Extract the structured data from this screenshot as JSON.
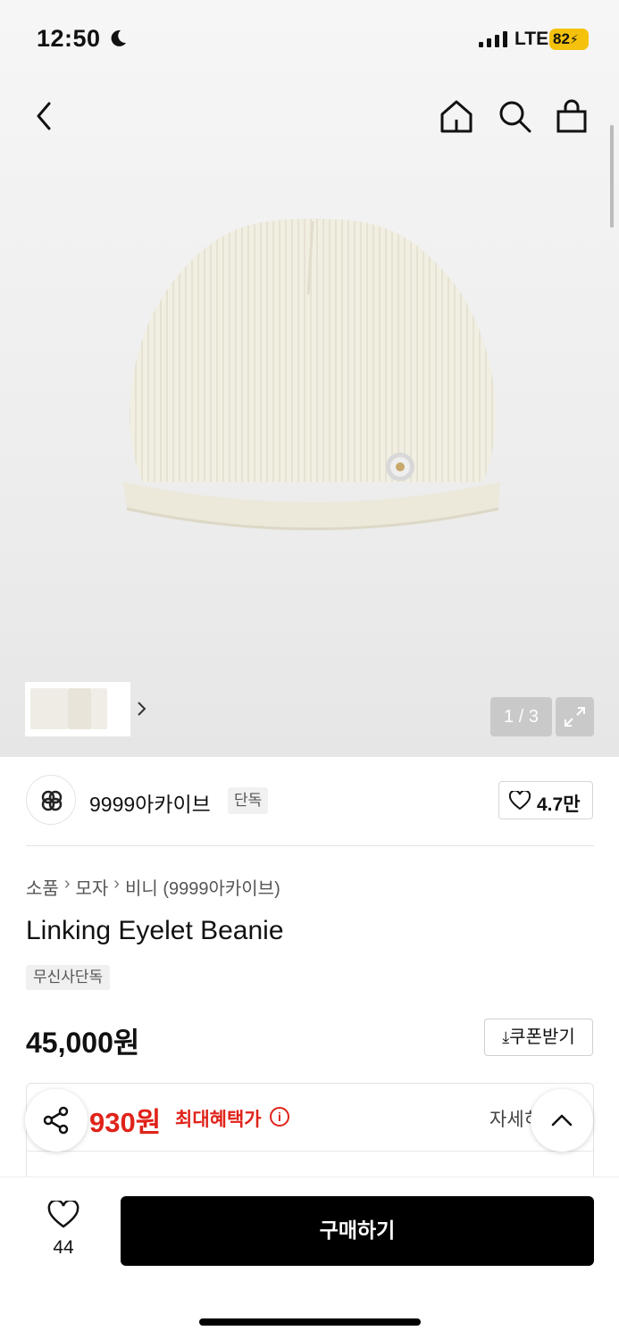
{
  "status_bar": {
    "time": "12:50",
    "network": "LTE",
    "battery": "82"
  },
  "nav": {
    "back_icon": "chevron-left-icon",
    "home_icon": "home-icon",
    "search_icon": "search-icon",
    "bag_icon": "shopping-bag-icon"
  },
  "gallery": {
    "pager": "1 / 3",
    "current_image": 1,
    "total_images": 3
  },
  "brand": {
    "name": "9999아카이브",
    "badge": "단독",
    "likes": "4.7만"
  },
  "breadcrumb": {
    "items": [
      "소품",
      "모자",
      "비니 (9999아카이브)"
    ]
  },
  "product": {
    "title": "Linking Eyelet Beanie",
    "tag": "무신사단독",
    "price": "45,000원"
  },
  "coupon": {
    "label": "쿠폰받기"
  },
  "benefit": {
    "price": "930원",
    "label": "최대혜택가",
    "detail": "자세히"
  },
  "bottom": {
    "wish_count": "44",
    "buy_label": "구매하기"
  },
  "colors": {
    "accent_red": "#e0231a",
    "buy_button": "#000000",
    "battery": "#f4c20d"
  }
}
